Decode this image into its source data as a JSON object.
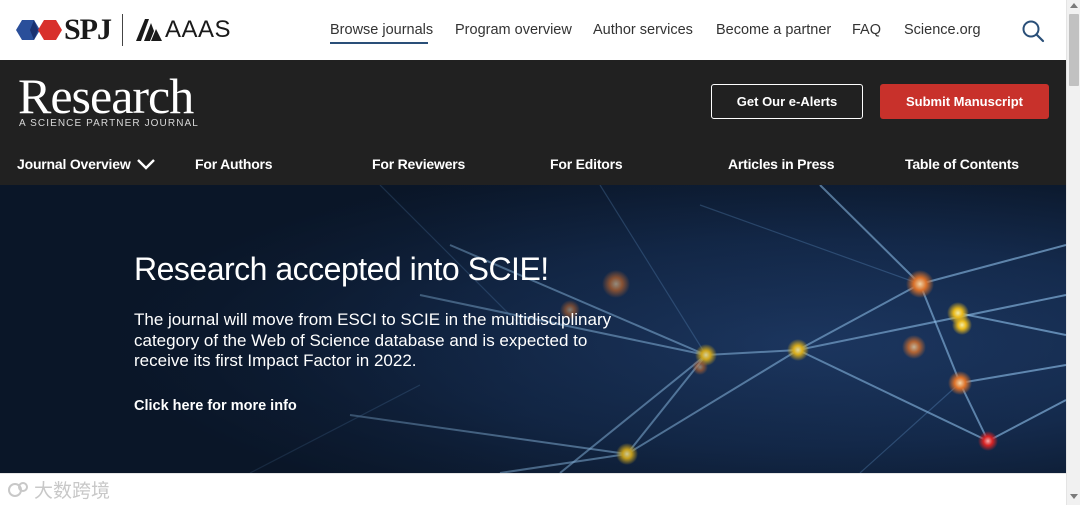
{
  "header": {
    "logo_primary": "SPJ",
    "logo_secondary": "AAAS",
    "nav": [
      {
        "label": "Browse journals",
        "active": true
      },
      {
        "label": "Program overview"
      },
      {
        "label": "Author services"
      },
      {
        "label": "Become a partner"
      },
      {
        "label": "FAQ"
      },
      {
        "label": "Science.org"
      }
    ],
    "search_icon": "search-icon"
  },
  "journal": {
    "title": "Research",
    "subtitle": "A SCIENCE PARTNER JOURNAL",
    "alerts_label": "Get Our e-Alerts",
    "submit_label": "Submit Manuscript",
    "menu": [
      {
        "label": "Journal Overview",
        "has_dropdown": true
      },
      {
        "label": "For Authors"
      },
      {
        "label": "For Reviewers"
      },
      {
        "label": "For Editors"
      },
      {
        "label": "Articles in Press"
      },
      {
        "label": "Table of Contents"
      }
    ]
  },
  "hero": {
    "title": "Research accepted into SCIE!",
    "body": "The journal will move from ESCI to SCIE in the multidisciplinary category of the Web of Science database and is expected to receive its first Impact Factor in 2022.",
    "link": "Click here for more info"
  },
  "watermark": {
    "text": "大数跨境"
  },
  "colors": {
    "dark_bg": "#212121",
    "submit_red": "#c8312b",
    "nav_underline": "#2a4f78",
    "hero_bg": "#0d1d33"
  }
}
